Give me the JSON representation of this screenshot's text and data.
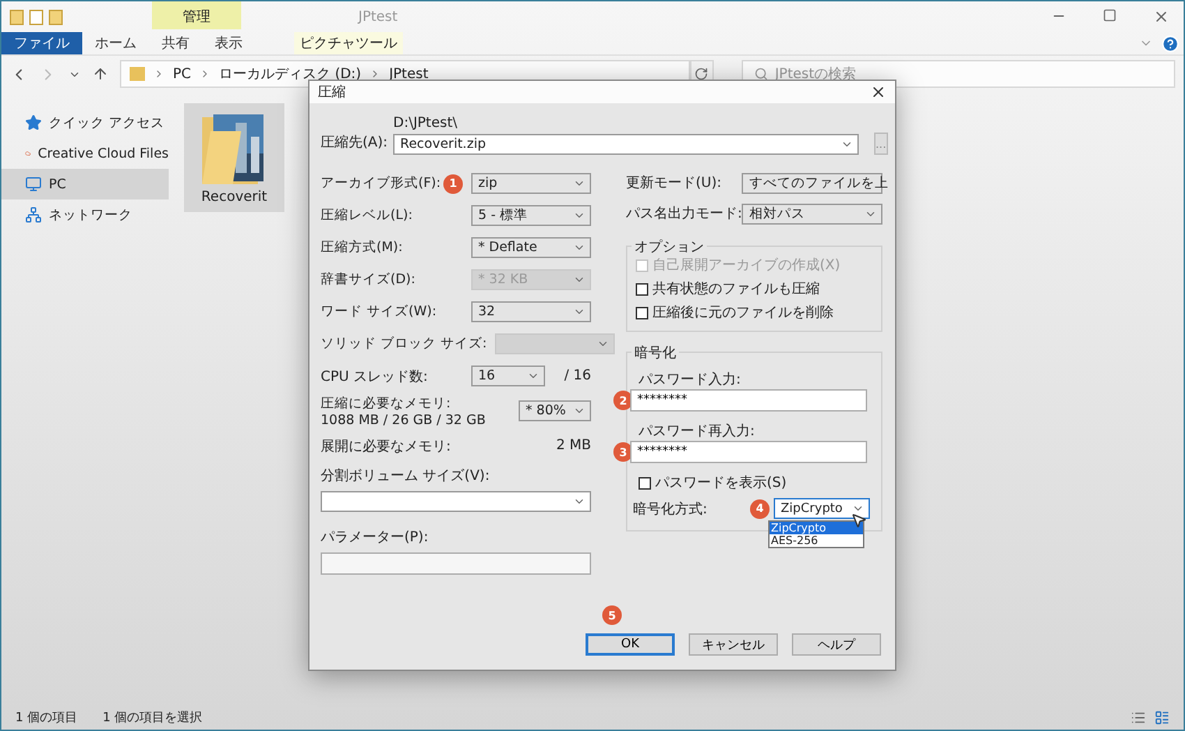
{
  "explorer": {
    "title": "JPtest",
    "contextual_tab": {
      "group": "管理",
      "label": "ピクチャツール"
    },
    "ribbon_tabs": [
      {
        "label": "ファイル",
        "selected": true
      },
      {
        "label": "ホーム",
        "selected": false
      },
      {
        "label": "共有",
        "selected": false
      },
      {
        "label": "表示",
        "selected": false
      }
    ],
    "breadcrumb": [
      "PC",
      "ローカルディスク (D:)",
      "JPtest"
    ],
    "search": {
      "placeholder": "JPtestの検索"
    },
    "nav_items": [
      {
        "label": "クイック アクセス",
        "kind": "star",
        "selected": false
      },
      {
        "label": "Creative Cloud Files",
        "kind": "cloud",
        "selected": false
      },
      {
        "label": "PC",
        "kind": "pc",
        "selected": true
      },
      {
        "label": "ネットワーク",
        "kind": "network",
        "selected": false
      }
    ],
    "files": [
      {
        "name": "Recoverit",
        "selected": true
      }
    ],
    "status_bar": [
      "1 個の項目",
      "1 個の項目を選択"
    ]
  },
  "dialog": {
    "title": "圧縮",
    "destination": {
      "label": "圧縮先(A):",
      "path": "D:\\JPtest\\",
      "value": "Recoverit.zip"
    },
    "browse": "...",
    "left_fields": [
      {
        "kind": "combo",
        "label": "アーカイブ形式(F):",
        "value": "zip",
        "step": "1",
        "disabled": false
      },
      {
        "kind": "combo",
        "label": "圧縮レベル(L):",
        "value": "5 - 標準",
        "disabled": false
      },
      {
        "kind": "combo",
        "label": "圧縮方式(M):",
        "value": "* Deflate",
        "disabled": false
      },
      {
        "kind": "combo",
        "label": "辞書サイズ(D):",
        "value": "* 32 KB",
        "disabled": true
      },
      {
        "kind": "combo",
        "label": "ワード サイズ(W):",
        "value": "32",
        "disabled": false
      },
      {
        "kind": "combo",
        "label": "ソリッド ブロック サイズ:",
        "disabled": true
      },
      {
        "kind": "threads",
        "label": "CPU スレッド数:",
        "value": "16",
        "total": "/ 16"
      },
      {
        "kind": "memory",
        "label": "圧縮に必要なメモリ:",
        "detail": "1088 MB / 26 GB / 32 GB",
        "value": "* 80%"
      },
      {
        "kind": "info",
        "label": "展開に必要なメモリ:",
        "value": "2 MB"
      },
      {
        "kind": "stacked_combo",
        "label": "分割ボリューム サイズ(V):"
      },
      {
        "kind": "stacked_input",
        "label": "パラメーター(P):"
      }
    ],
    "right_fields": [
      {
        "label": "更新モード(U):",
        "value": "すべてのファイルを上"
      },
      {
        "label": "パス名出力モード:",
        "value": "相対パス"
      }
    ],
    "options": {
      "title": "オプション",
      "items": [
        {
          "label": "自己展開アーカイブの作成(X)",
          "checked": false,
          "disabled": true
        },
        {
          "label": "共有状態のファイルも圧縮",
          "checked": false,
          "disabled": false
        },
        {
          "label": "圧縮後に元のファイルを削除",
          "checked": false,
          "disabled": false
        }
      ]
    },
    "encryption": {
      "title": "暗号化",
      "passwords": [
        {
          "label": "パスワード入力:",
          "value": "********",
          "step": "2"
        },
        {
          "label": "パスワード再入力:",
          "value": "********",
          "step": "3"
        }
      ],
      "show_password": {
        "label": "パスワードを表示(S)",
        "checked": false
      },
      "method": {
        "label": "暗号化方式:",
        "value": "ZipCrypto",
        "step": "4",
        "expanded": true,
        "options": [
          {
            "label": "ZipCrypto",
            "selected": true
          },
          {
            "label": "AES-256",
            "selected": false
          }
        ]
      }
    },
    "buttons": [
      {
        "label": "OK",
        "default": true,
        "step": "5"
      },
      {
        "label": "キャンセル",
        "default": false
      },
      {
        "label": "ヘルプ",
        "default": false
      }
    ]
  }
}
